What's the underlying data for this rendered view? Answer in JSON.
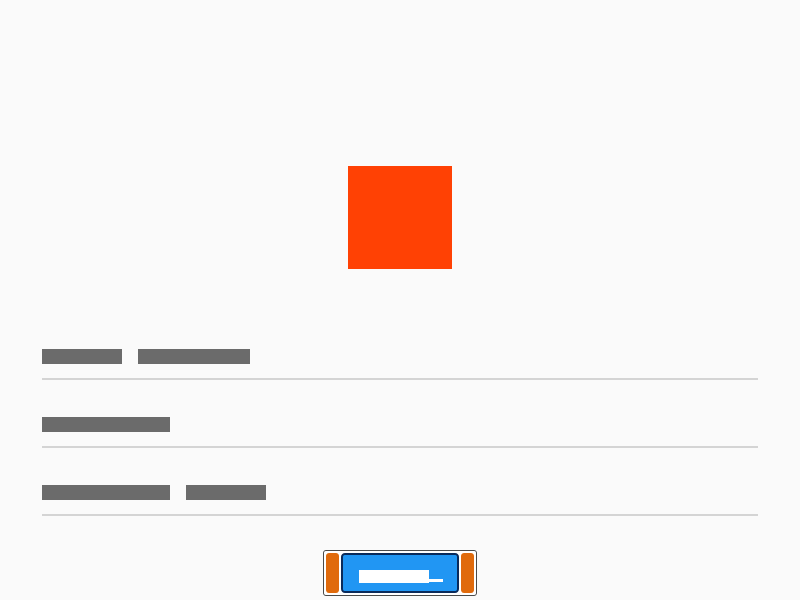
{
  "colors": {
    "background": "#fafafa",
    "swatch": "#ff4104",
    "placeholder_text": "#6b6b6b",
    "divider": "#d4d4d4",
    "primary_button": "#2196f3",
    "button_accent": "#e06a0c"
  },
  "swatch": {
    "icon": "color-swatch"
  },
  "rows": [
    {
      "text_blocks": 2
    },
    {
      "text_blocks": 1
    },
    {
      "text_blocks": 2
    }
  ],
  "primary_action": {
    "icon": "primary-action-button"
  }
}
